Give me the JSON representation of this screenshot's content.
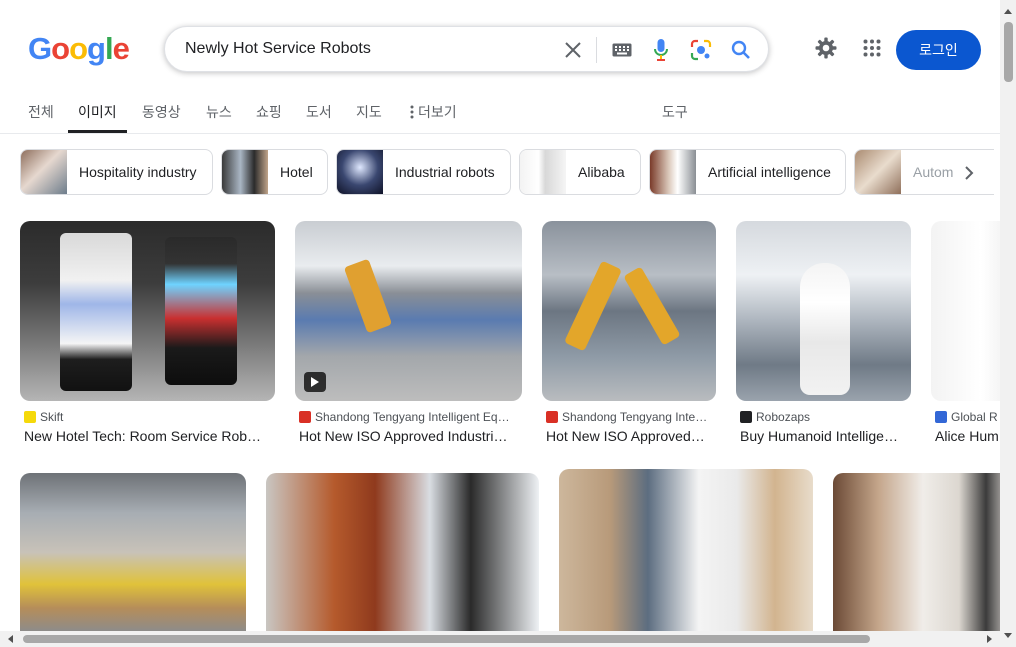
{
  "logo": {
    "letters": [
      "G",
      "o",
      "o",
      "g",
      "l",
      "e"
    ],
    "colors": [
      "#4285F4",
      "#EA4335",
      "#FBBC05",
      "#4285F4",
      "#34A853",
      "#EA4335"
    ]
  },
  "search": {
    "query": "Newly Hot Service Robots",
    "icons": [
      "close-icon",
      "keyboard-icon",
      "mic-icon",
      "lens-icon",
      "search-icon"
    ]
  },
  "header": {
    "login_label": "로그인",
    "icons": [
      "settings-icon",
      "apps-icon"
    ]
  },
  "tabs": [
    {
      "label": "전체",
      "active": false
    },
    {
      "label": "이미지",
      "active": true
    },
    {
      "label": "동영상",
      "active": false
    },
    {
      "label": "뉴스",
      "active": false
    },
    {
      "label": "쇼핑",
      "active": false
    },
    {
      "label": "도서",
      "active": false
    },
    {
      "label": "지도",
      "active": false
    },
    {
      "label": "더보기",
      "active": false
    }
  ],
  "tools_label": "도구",
  "chips": [
    {
      "label": "Hospitality industry"
    },
    {
      "label": "Hotel"
    },
    {
      "label": "Industrial robots"
    },
    {
      "label": "Alibaba"
    },
    {
      "label": "Artificial intelligence"
    },
    {
      "label": "Autom"
    }
  ],
  "results_row1": [
    {
      "source": "Skift",
      "title": "New Hotel Tech: Room Service Rob…",
      "fav_color": "#f5d90a",
      "video": false
    },
    {
      "source": "Shandong Tengyang Intelligent Eq…",
      "title": "Hot New ISO Approved Industri…",
      "fav_color": "#d93025",
      "video": true
    },
    {
      "source": "Shandong Tengyang Inte…",
      "title": "Hot New ISO Approved…",
      "fav_color": "#d93025",
      "video": false
    },
    {
      "source": "Robozaps",
      "title": "Buy Humanoid Intellige…",
      "fav_color": "#202124",
      "video": false
    },
    {
      "source": "Global R",
      "title": "Alice Hum",
      "fav_color": "#3367d6",
      "video": false
    }
  ],
  "results_row2": [
    {
      "desc": "warehouse-robot"
    },
    {
      "desc": "woman-with-robot"
    },
    {
      "desc": "delivery-robot"
    },
    {
      "desc": "pepper-robot"
    }
  ]
}
